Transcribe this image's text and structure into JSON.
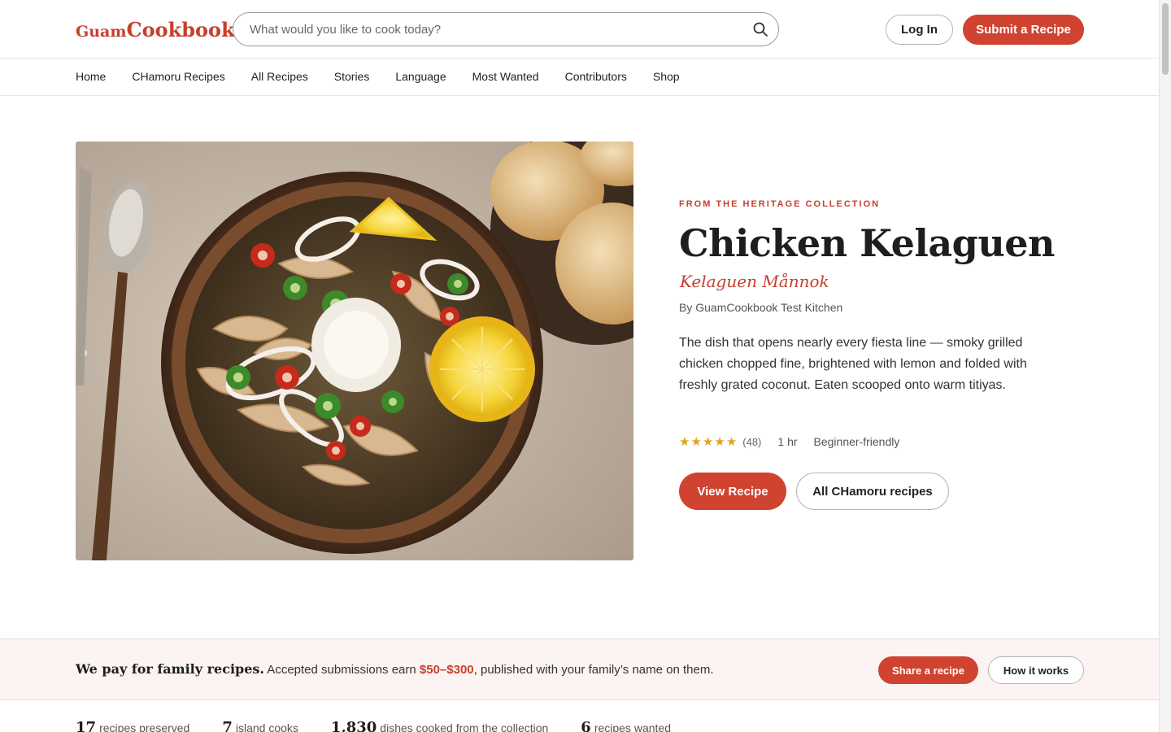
{
  "header": {
    "logo_prefix": "Guam",
    "logo_main": "Cookbook",
    "search_placeholder": "What would you like to cook today?",
    "login_label": "Log In",
    "submit_label": "Submit a Recipe"
  },
  "nav": {
    "items": [
      "Home",
      "CHamoru Recipes",
      "All Recipes",
      "Stories",
      "Language",
      "Most Wanted",
      "Contributors",
      "Shop"
    ]
  },
  "hero": {
    "eyebrow": "FROM THE HERITAGE COLLECTION",
    "title": "Chicken Kelaguen",
    "subtitle": "Kelaguen Månnok",
    "byline": "By GuamCookbook Test Kitchen",
    "description": "The dish that opens nearly every fiesta line — smoky grilled chicken chopped fine, brightened with lemon and folded with freshly grated coconut. Eaten scooped onto warm titiyas.",
    "rating_stars": 5,
    "rating_count": "(48)",
    "time": "1 hr",
    "level": "Beginner-friendly",
    "view_label": "View Recipe",
    "all_label": "All CHamoru recipes"
  },
  "banner": {
    "strong": "We pay for family recipes.",
    "text_before": " Accepted submissions earn ",
    "amount": "$50–$300",
    "text_after": ", published with your family’s name on them.",
    "share_label": "Share a recipe",
    "how_label": "How it works"
  },
  "stats": [
    {
      "num": "17",
      "label": "recipes preserved"
    },
    {
      "num": "7",
      "label": "island cooks"
    },
    {
      "num": "1,830",
      "label": "dishes cooked from the collection"
    },
    {
      "num": "6",
      "label": "recipes wanted"
    }
  ],
  "colors": {
    "brand": "#cf4330",
    "star": "#e2a417"
  },
  "icons": {
    "search": "search-icon",
    "star": "star-icon"
  }
}
